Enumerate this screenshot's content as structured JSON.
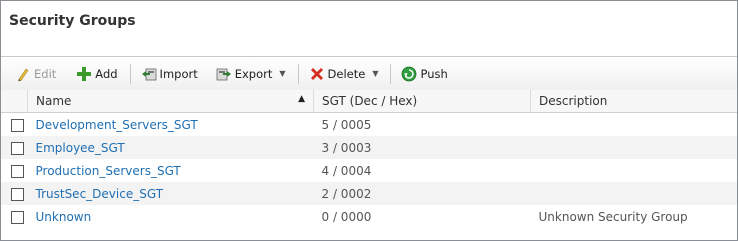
{
  "title": "Security Groups",
  "toolbar": {
    "edit_label": "Edit",
    "add_label": "Add",
    "import_label": "Import",
    "export_label": "Export",
    "delete_label": "Delete",
    "push_label": "Push"
  },
  "table": {
    "columns": {
      "name": "Name",
      "sgt": "SGT (Dec / Hex)",
      "description": "Description"
    },
    "rows": [
      {
        "name": "Development_Servers_SGT",
        "sgt": "5 / 0005",
        "description": ""
      },
      {
        "name": "Employee_SGT",
        "sgt": "3 / 0003",
        "description": ""
      },
      {
        "name": "Production_Servers_SGT",
        "sgt": "4 / 0004",
        "description": ""
      },
      {
        "name": "TrustSec_Device_SGT",
        "sgt": "2 / 0002",
        "description": ""
      },
      {
        "name": "Unknown",
        "sgt": "0 / 0000",
        "description": "Unknown Security Group"
      }
    ]
  },
  "icons": {
    "edit": "pencil-icon",
    "add": "plus-icon",
    "import": "import-icon",
    "export": "export-icon",
    "delete": "delete-x-icon",
    "push": "push-icon"
  },
  "colors": {
    "link": "#1f6fb2",
    "delete_red": "#d62b1f",
    "add_green": "#3a9a2a",
    "push_green": "#2e9e3e"
  }
}
